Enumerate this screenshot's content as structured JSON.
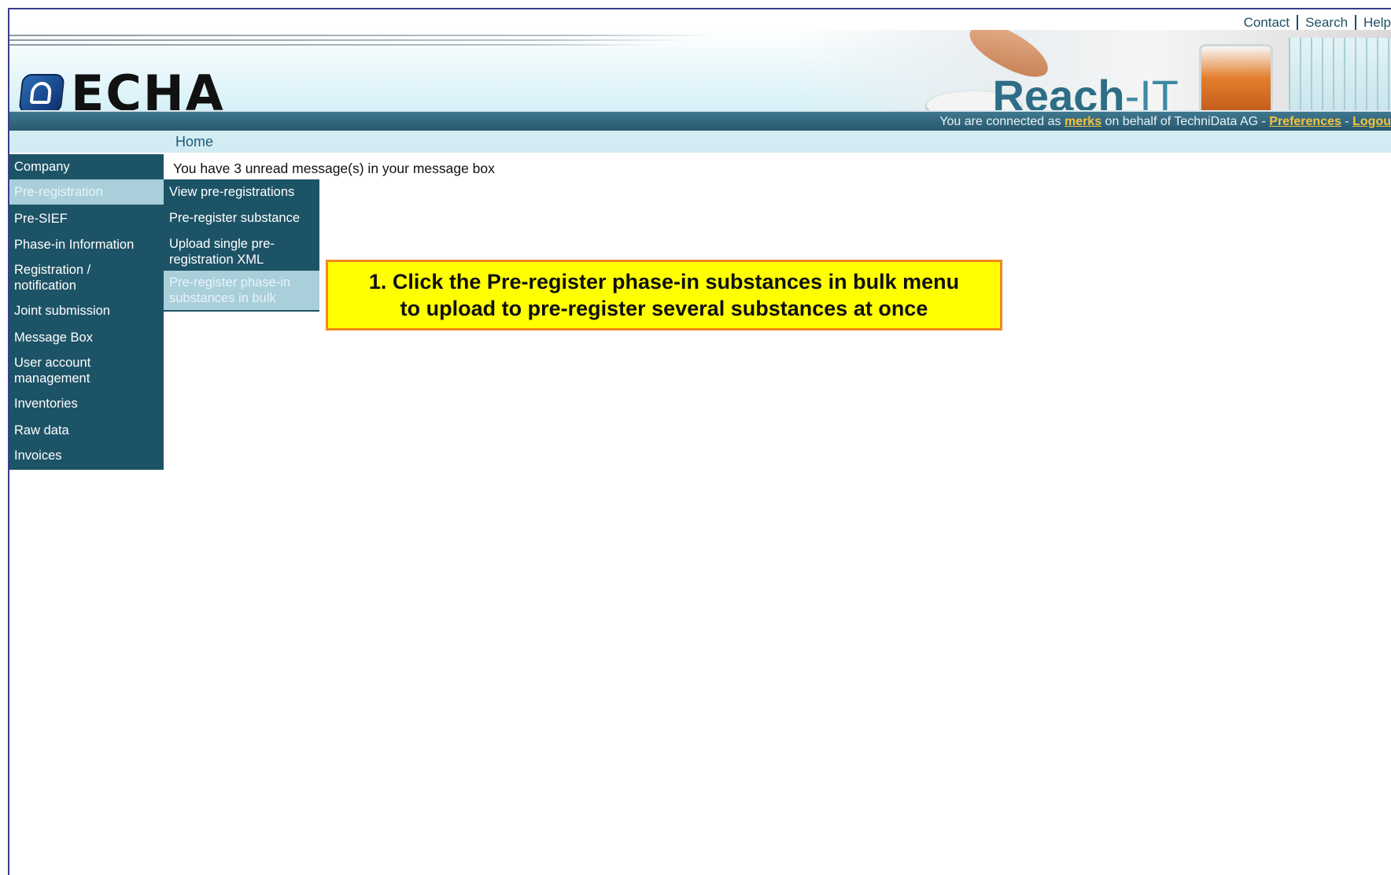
{
  "top_links": [
    "Contact",
    "Search",
    "Help"
  ],
  "header": {
    "logo_text": "ECHA",
    "app_name_main": "Reach",
    "app_name_suffix": "-IT"
  },
  "status": {
    "prefix": "You are connected as ",
    "user": "merks",
    "middle": " on behalf of TechniData AG - ",
    "preferences": "Preferences",
    "dash": " - ",
    "logout": "Logou"
  },
  "breadcrumb": "Home",
  "message": "You have 3 unread message(s) in your message box",
  "sidebar": {
    "items": [
      {
        "label": "Company",
        "active": false
      },
      {
        "label": "Pre-registration",
        "active": true
      },
      {
        "label": "Pre-SIEF",
        "active": false
      },
      {
        "label": "Phase-in Information",
        "active": false
      },
      {
        "label": "Registration / notification",
        "active": false
      },
      {
        "label": "Joint submission",
        "active": false
      },
      {
        "label": "Message Box",
        "active": false
      },
      {
        "label": "User account management",
        "active": false
      },
      {
        "label": "Inventories",
        "active": false
      },
      {
        "label": "Raw data",
        "active": false
      },
      {
        "label": "Invoices",
        "active": false
      }
    ]
  },
  "submenu": {
    "items": [
      {
        "label": "View pre-registrations",
        "active": false
      },
      {
        "label": "Pre-register substance",
        "active": false
      },
      {
        "label": "Upload single pre-registration XML",
        "active": false
      },
      {
        "label": "Pre-register phase-in substances in bulk",
        "active": true
      }
    ]
  },
  "callout": {
    "line1": "1. Click the Pre-register phase-in substances in bulk menu",
    "line2": "to upload to pre-register several substances at once"
  },
  "colors": {
    "nav_bg": "#1d5366",
    "nav_active_bg": "#a9cfdb",
    "callout_bg": "#ffff00",
    "callout_border": "#f08a1a",
    "link_accent": "#f7c23b"
  }
}
